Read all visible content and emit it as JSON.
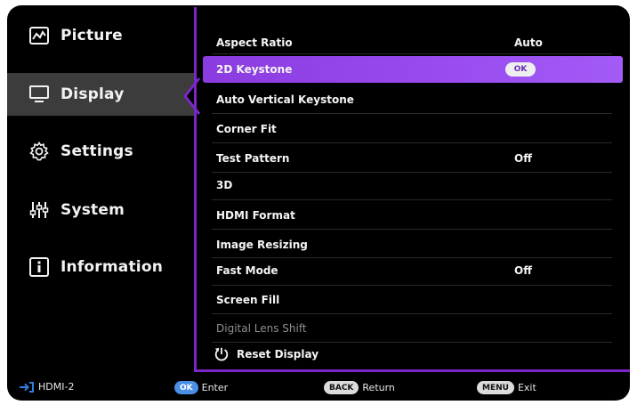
{
  "sidebar": {
    "items": [
      {
        "label": "Picture",
        "icon": "picture-icon"
      },
      {
        "label": "Display",
        "icon": "monitor-icon",
        "active": true
      },
      {
        "label": "Settings",
        "icon": "gear-icon"
      },
      {
        "label": "System",
        "icon": "sliders-icon"
      },
      {
        "label": "Information",
        "icon": "info-icon"
      }
    ]
  },
  "menu": {
    "rows": [
      {
        "label": "Aspect Ratio",
        "value": "Auto"
      },
      {
        "label": "2D Keystone",
        "value": "",
        "badge": "OK"
      },
      {
        "label": "Auto Vertical Keystone",
        "value": ""
      },
      {
        "label": "Corner Fit",
        "value": ""
      },
      {
        "label": "Test Pattern",
        "value": "Off"
      },
      {
        "label": "3D",
        "value": ""
      },
      {
        "label": "HDMI Format",
        "value": ""
      },
      {
        "label": "Image Resizing",
        "value": ""
      },
      {
        "label": "Fast Mode",
        "value": "Off"
      },
      {
        "label": "Screen Fill",
        "value": ""
      },
      {
        "label": "Digital Lens Shift",
        "value": ""
      },
      {
        "label": "Reset Display",
        "value": ""
      }
    ]
  },
  "footer": {
    "source": "HDMI-2",
    "ok_key": "OK",
    "ok_label": "Enter",
    "back_key": "BACK",
    "back_label": "Return",
    "menu_key": "MENU",
    "menu_label": "Exit"
  },
  "colors": {
    "accent": "#7a26c8",
    "highlight": "#9a4cf0",
    "key_blue": "#2f7fe0"
  }
}
